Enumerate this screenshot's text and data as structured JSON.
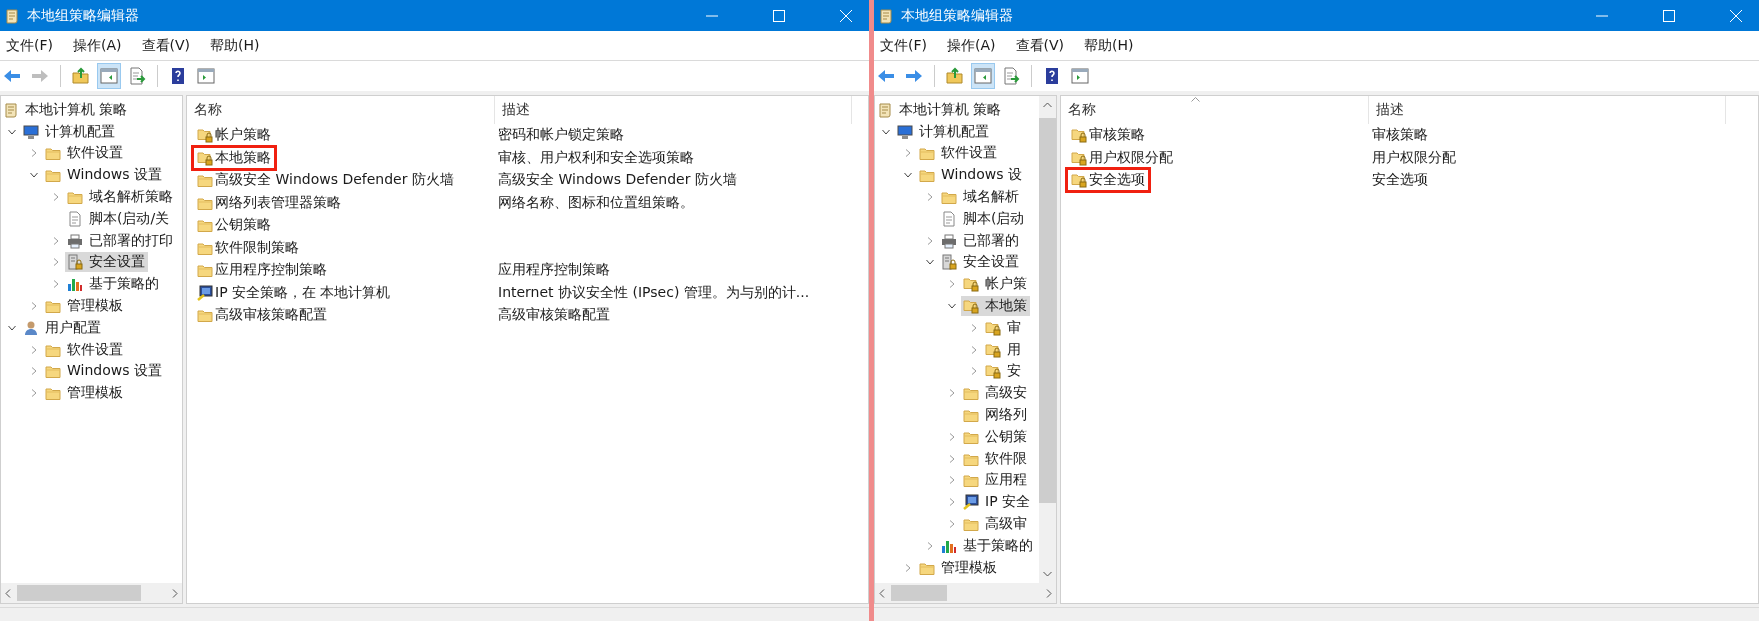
{
  "windows": [
    {
      "title": "本地组策略编辑器",
      "menu": [
        "文件(F)",
        "操作(A)",
        "查看(V)",
        "帮助(H)"
      ],
      "toolbar": [
        [
          {
            "kind": "back",
            "disabled": false,
            "pressed": false
          },
          {
            "kind": "forward",
            "disabled": true,
            "pressed": false
          }
        ],
        [
          {
            "kind": "up",
            "disabled": false,
            "pressed": false
          },
          {
            "kind": "tree",
            "disabled": false,
            "pressed": true
          },
          {
            "kind": "export",
            "disabled": false,
            "pressed": false
          }
        ],
        [
          {
            "kind": "help",
            "disabled": false,
            "pressed": false
          },
          {
            "kind": "pane",
            "disabled": false,
            "pressed": false
          }
        ]
      ],
      "tree_vertical_scrollbar": false,
      "tree": [
        {
          "label": "本地计算机 策略",
          "kind": "scroll",
          "expandable": false,
          "selected": false,
          "children": [
            {
              "label": "计算机配置",
              "kind": "computer",
              "expandable": true,
              "expanded": true,
              "selected": false,
              "children": [
                {
                  "label": "软件设置",
                  "kind": "folder",
                  "expandable": true,
                  "expanded": false,
                  "selected": false
                },
                {
                  "label": "Windows 设置",
                  "kind": "folder",
                  "expandable": true,
                  "expanded": true,
                  "selected": false,
                  "children": [
                    {
                      "label": "域名解析策略",
                      "kind": "folder",
                      "expandable": true,
                      "expanded": false,
                      "selected": false
                    },
                    {
                      "label": "脚本(启动/关",
                      "kind": "script",
                      "expandable": false,
                      "selected": false
                    },
                    {
                      "label": "已部署的打印",
                      "kind": "printer",
                      "expandable": true,
                      "expanded": false,
                      "selected": false
                    },
                    {
                      "label": "安全设置",
                      "kind": "security",
                      "expandable": true,
                      "expanded": false,
                      "selected": true
                    },
                    {
                      "label": "基于策略的",
                      "kind": "chart",
                      "expandable": true,
                      "expanded": false,
                      "selected": false
                    }
                  ]
                },
                {
                  "label": "管理模板",
                  "kind": "folder",
                  "expandable": true,
                  "expanded": false,
                  "selected": false
                }
              ]
            },
            {
              "label": "用户配置",
              "kind": "user",
              "expandable": true,
              "expanded": true,
              "selected": false,
              "children": [
                {
                  "label": "软件设置",
                  "kind": "folder",
                  "expandable": true,
                  "expanded": false,
                  "selected": false
                },
                {
                  "label": "Windows 设置",
                  "kind": "folder",
                  "expandable": true,
                  "expanded": false,
                  "selected": false
                },
                {
                  "label": "管理模板",
                  "kind": "folder",
                  "expandable": true,
                  "expanded": false,
                  "selected": false
                }
              ]
            }
          ]
        }
      ],
      "list": {
        "columns": [
          {
            "label": "名称",
            "sorted": false
          },
          {
            "label": "描述",
            "sorted": false
          }
        ],
        "rows": [
          {
            "name": "帐户策略",
            "description": "密码和帐户锁定策略",
            "kind": "lock-folder",
            "marked": false
          },
          {
            "name": "本地策略",
            "description": "审核、用户权利和安全选项策略",
            "kind": "lock-folder",
            "marked": true
          },
          {
            "name": "高级安全 Windows Defender 防火墙",
            "description": "高级安全 Windows Defender 防火墙",
            "kind": "folder",
            "marked": false
          },
          {
            "name": "网络列表管理器策略",
            "description": "网络名称、图标和位置组策略。",
            "kind": "folder",
            "marked": false
          },
          {
            "name": "公钥策略",
            "kind": "folder",
            "marked": false
          },
          {
            "name": "软件限制策略",
            "kind": "folder",
            "marked": false
          },
          {
            "name": "应用程序控制策略",
            "description": "应用程序控制策略",
            "kind": "folder",
            "marked": false
          },
          {
            "name": "IP 安全策略，在 本地计算机",
            "description": "Internet 协议安全性 (IPsec) 管理。为与别的计...",
            "kind": "ipsec",
            "marked": false
          },
          {
            "name": "高级审核策略配置",
            "description": "高级审核策略配置",
            "kind": "folder",
            "marked": false
          }
        ]
      }
    },
    {
      "title": "本地组策略编辑器",
      "menu": [
        "文件(F)",
        "操作(A)",
        "查看(V)",
        "帮助(H)"
      ],
      "toolbar": [
        [
          {
            "kind": "back",
            "disabled": false,
            "pressed": false
          },
          {
            "kind": "forward",
            "disabled": false,
            "pressed": false
          }
        ],
        [
          {
            "kind": "up",
            "disabled": false,
            "pressed": false
          },
          {
            "kind": "tree",
            "disabled": false,
            "pressed": true
          },
          {
            "kind": "export",
            "disabled": false,
            "pressed": false
          }
        ],
        [
          {
            "kind": "help",
            "disabled": false,
            "pressed": false
          },
          {
            "kind": "pane",
            "disabled": false,
            "pressed": false
          }
        ]
      ],
      "tree_vertical_scrollbar": true,
      "tree": [
        {
          "label": "本地计算机 策略",
          "kind": "scroll",
          "expandable": false,
          "selected": false,
          "children": [
            {
              "label": "计算机配置",
              "kind": "computer",
              "expandable": true,
              "expanded": true,
              "selected": false,
              "children": [
                {
                  "label": "软件设置",
                  "kind": "folder",
                  "expandable": true,
                  "expanded": false,
                  "selected": false
                },
                {
                  "label": "Windows 设",
                  "kind": "folder",
                  "expandable": true,
                  "expanded": true,
                  "selected": false,
                  "children": [
                    {
                      "label": "域名解析",
                      "kind": "folder",
                      "expandable": true,
                      "expanded": false,
                      "selected": false
                    },
                    {
                      "label": "脚本(启动",
                      "kind": "script",
                      "expandable": false,
                      "selected": false
                    },
                    {
                      "label": "已部署的",
                      "kind": "printer",
                      "expandable": true,
                      "expanded": false,
                      "selected": false
                    },
                    {
                      "label": "安全设置",
                      "kind": "security",
                      "expandable": true,
                      "expanded": true,
                      "selected": false,
                      "children": [
                        {
                          "label": "帐户策",
                          "kind": "lock-folder",
                          "expandable": true,
                          "expanded": false,
                          "selected": false
                        },
                        {
                          "label": "本地策",
                          "kind": "lock-folder",
                          "expandable": true,
                          "expanded": true,
                          "selected": true,
                          "children": [
                            {
                              "label": "审",
                              "kind": "lock-folder",
                              "expandable": true,
                              "expanded": false,
                              "selected": false
                            },
                            {
                              "label": "用",
                              "kind": "lock-folder",
                              "expandable": true,
                              "expanded": false,
                              "selected": false
                            },
                            {
                              "label": "安",
                              "kind": "lock-folder",
                              "expandable": true,
                              "expanded": false,
                              "selected": false
                            }
                          ]
                        },
                        {
                          "label": "高级安",
                          "kind": "folder",
                          "expandable": true,
                          "expanded": false,
                          "selected": false
                        },
                        {
                          "label": "网络列",
                          "kind": "folder",
                          "expandable": false,
                          "selected": false
                        },
                        {
                          "label": "公钥策",
                          "kind": "folder",
                          "expandable": true,
                          "expanded": false,
                          "selected": false
                        },
                        {
                          "label": "软件限",
                          "kind": "folder",
                          "expandable": true,
                          "expanded": false,
                          "selected": false
                        },
                        {
                          "label": "应用程",
                          "kind": "folder",
                          "expandable": true,
                          "expanded": false,
                          "selected": false
                        },
                        {
                          "label": "IP 安全",
                          "kind": "ipsec",
                          "expandable": true,
                          "expanded": false,
                          "selected": false
                        },
                        {
                          "label": "高级审",
                          "kind": "folder",
                          "expandable": true,
                          "expanded": false,
                          "selected": false
                        }
                      ]
                    },
                    {
                      "label": "基于策略的",
                      "kind": "chart",
                      "expandable": true,
                      "expanded": false,
                      "selected": false
                    }
                  ]
                },
                {
                  "label": "管理模板",
                  "kind": "folder",
                  "expandable": true,
                  "expanded": false,
                  "selected": false
                }
              ]
            }
          ]
        }
      ],
      "list": {
        "columns": [
          {
            "label": "名称",
            "sorted": true
          },
          {
            "label": "描述",
            "sorted": false
          }
        ],
        "rows": [
          {
            "name": "审核策略",
            "description": "审核策略",
            "kind": "lock-folder",
            "marked": false
          },
          {
            "name": "用户权限分配",
            "description": "用户权限分配",
            "kind": "lock-folder",
            "marked": false
          },
          {
            "name": "安全选项",
            "description": "安全选项",
            "kind": "lock-folder",
            "marked": true
          }
        ]
      }
    }
  ]
}
